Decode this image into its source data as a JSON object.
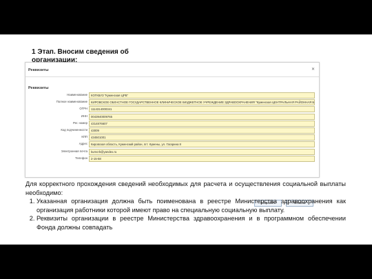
{
  "slide": {
    "heading": "1 Этап. Вносим сведения об организации:",
    "body_intro": "Для корректного прохождения сведений необходимых для расчета и осуществления социальной выплаты необходимо:",
    "body_items": [
      "Указанная организация должна быть поименована в реестре Министерства здравоохранения как организация работники которой имеют право на специальную социальную выплату.",
      "Реквизиты организации в реестре Министерства здравоохранения и в программном обеспечении Фонда должны совпадать"
    ]
  },
  "window": {
    "title": "Реквизиты",
    "close": "✕",
    "section": "Реквизиты",
    "fields": [
      {
        "label": "Наименование",
        "value": "КОГКБУЗ \"Куменская ЦРБ\"",
        "size": "wide"
      },
      {
        "label": "Полное наименование",
        "value": "КИРОВСКОЕ ОБЛАСТНОЕ ГОСУДАРСТВЕННОЕ КЛИНИЧЕСКОЕ БЮДЖЕТНОЕ УЧРЕЖДЕНИЕ ЗДРАВООХРАНЕНИЯ \"Куменская ЦЕНТРАЛЬНАЯ РАЙОННАЯ БОЛЬНИЦА\"",
        "size": "wide"
      },
      {
        "label": "ОГРН",
        "value": "1114314000341",
        "size": "wide"
      },
      {
        "label": "ИНН",
        "value": "0043940009765",
        "size": "wide"
      },
      {
        "label": "Рег. номер",
        "value": "4314876607",
        "size": "wide"
      },
      {
        "label": "Код подчиненности",
        "value": "43009",
        "size": "wide"
      },
      {
        "label": "КПП",
        "value": "434501001",
        "size": "wide"
      },
      {
        "label": "Адрес",
        "value": "Кировская область, Куменский район, пгт. Кумены, ул. Гагарина 8",
        "size": "wide"
      },
      {
        "label": "Электронная почта",
        "value": "kumcrb@yandex.ru",
        "size": "wide"
      },
      {
        "label": "Телефон",
        "value": "2-15-58",
        "size": "wide"
      }
    ],
    "save_label": "Сохранить",
    "cancel_label": "Отмена"
  }
}
